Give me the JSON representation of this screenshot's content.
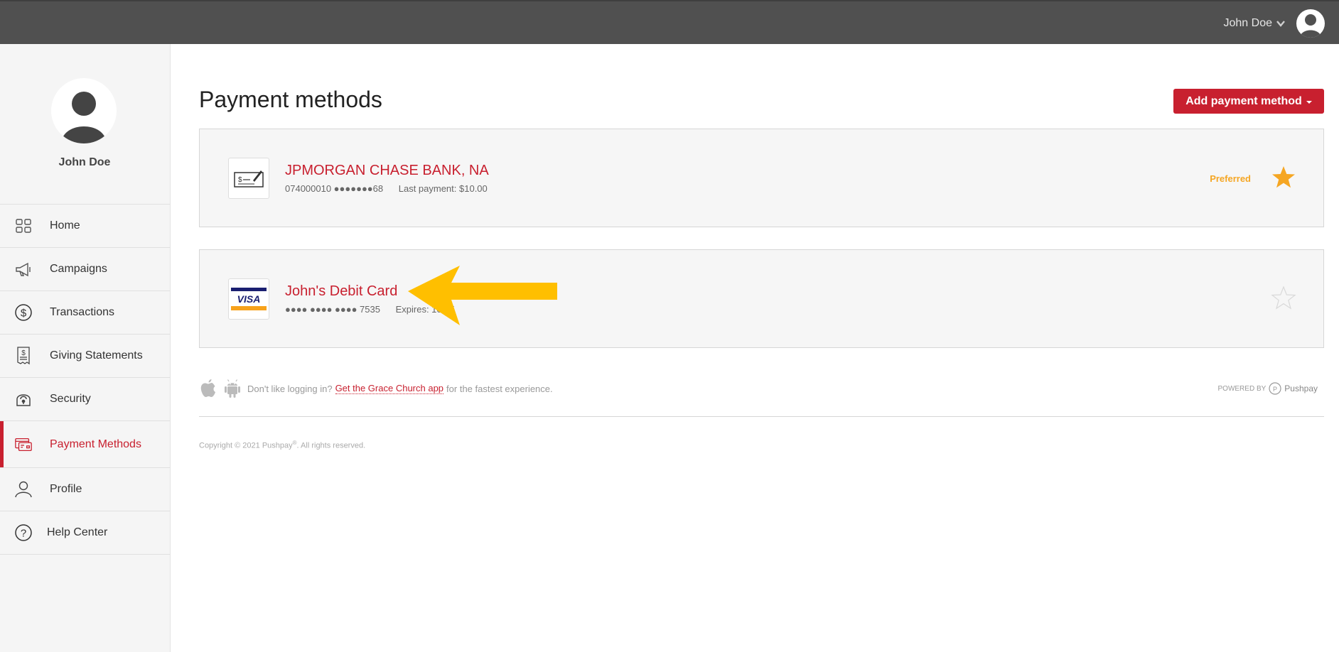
{
  "header": {
    "user_name": "John Doe",
    "icons": [
      "chevron-down-icon",
      "user-avatar-icon"
    ]
  },
  "sidebar": {
    "profile_name": "John Doe",
    "items": [
      {
        "label": "Home",
        "icon": "grid-icon"
      },
      {
        "label": "Campaigns",
        "icon": "megaphone-icon"
      },
      {
        "label": "Transactions",
        "icon": "dollar-circle-icon"
      },
      {
        "label": "Giving Statements",
        "icon": "receipt-icon"
      },
      {
        "label": "Security",
        "icon": "lock-icon"
      },
      {
        "label": "Payment Methods",
        "icon": "credit-card-icon",
        "active": true
      },
      {
        "label": "Profile",
        "icon": "person-icon"
      },
      {
        "label": "Help Center",
        "icon": "question-circle-icon"
      }
    ]
  },
  "main": {
    "title": "Payment methods",
    "add_button": "Add payment method",
    "methods": [
      {
        "name": "JPMORGAN CHASE BANK, NA",
        "account": "074000010 ●●●●●●●68",
        "detail": "Last payment: $10.00",
        "icon": "check-icon",
        "preferred_label": "Preferred",
        "preferred": true
      },
      {
        "name": "John's Debit Card",
        "account": "●●●● ●●●● ●●●● 7535",
        "detail": "Expires: 10/25",
        "icon": "visa-card-icon",
        "preferred": false
      }
    ]
  },
  "footer": {
    "promo_before": "Don't like logging in?",
    "promo_link": "Get the Grace Church app",
    "promo_after": "for the fastest experience.",
    "powered_by": "POWERED BY",
    "powered_name": "Pushpay",
    "copyright": "Copyright © 2021 Pushpay",
    "copyright_mark": "®",
    "copyright_tail": ". All rights reserved."
  },
  "colors": {
    "accent": "#c8202f",
    "topbar": "#505050",
    "preferred": "#f5a623",
    "annotation_arrow": "#ffbf00"
  }
}
